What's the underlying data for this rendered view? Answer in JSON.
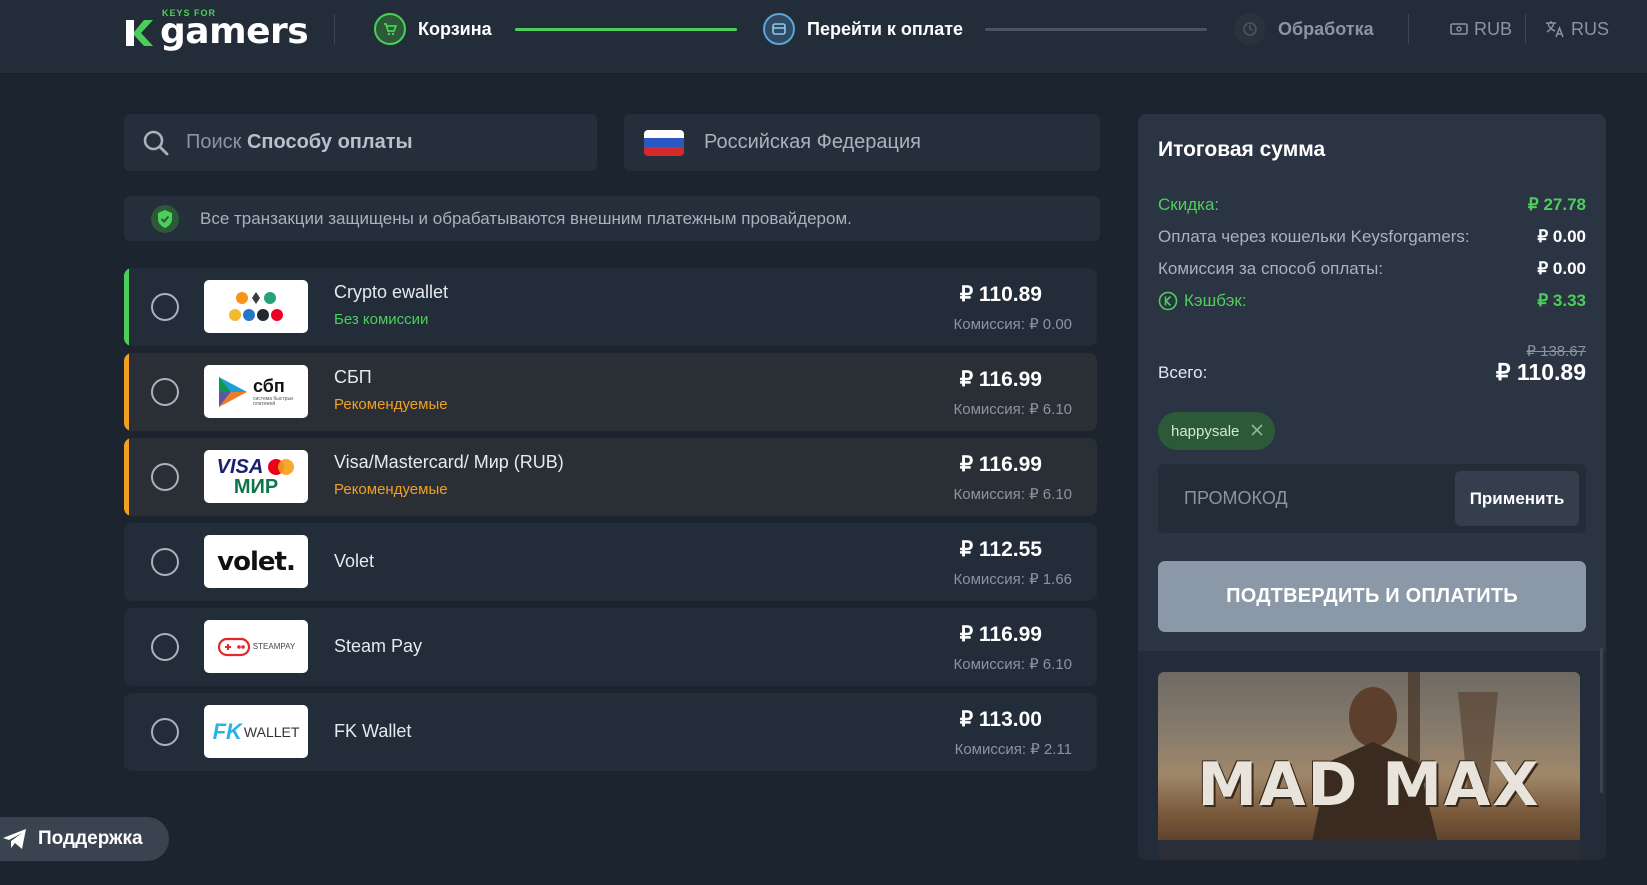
{
  "header": {
    "logo_small": "KEYS FOR",
    "logo_text": "gamers",
    "steps": [
      {
        "label": "Корзина",
        "state": "done",
        "icon": "cart-icon"
      },
      {
        "label": "Перейти к оплате",
        "state": "active",
        "icon": "card-icon"
      },
      {
        "label": "Обработка",
        "state": "pending",
        "icon": "clock-icon"
      }
    ],
    "currency": "RUB",
    "language": "RUS"
  },
  "search": {
    "placeholder_prefix": "Поиск",
    "placeholder_bold": "Способу оплаты"
  },
  "country": {
    "name": "Российская Федерация"
  },
  "notice": "Все транзакции защищены и обрабатываются внешним платежным провайдером.",
  "payment_methods": [
    {
      "name": "Crypto ewallet",
      "tag": "Без комиссии",
      "tag_color": "#4ccf5a",
      "accent": "#4ccf5a",
      "price": "₽ 110.89",
      "fee": "Комиссия: ₽ 0.00",
      "logo": "crypto-logo"
    },
    {
      "name": "СБП",
      "tag": "Рекомендуемые",
      "tag_color": "#f2a024",
      "accent": "#f2a024",
      "price": "₽ 116.99",
      "fee": "Комиссия: ₽ 6.10",
      "logo": "sbp-logo"
    },
    {
      "name": "Visa/Mastercard/ Мир (RUB)",
      "tag": "Рекомендуемые",
      "tag_color": "#f2a024",
      "accent": "#f2a024",
      "price": "₽ 116.99",
      "fee": "Комиссия: ₽ 6.10",
      "logo": "visa-mir-logo"
    },
    {
      "name": "Volet",
      "tag": "",
      "price": "₽ 112.55",
      "fee": "Комиссия: ₽ 1.66",
      "logo": "volet-logo",
      "logo_text": "volet."
    },
    {
      "name": "Steam Pay",
      "tag": "",
      "price": "₽ 116.99",
      "fee": "Комиссия: ₽ 6.10",
      "logo": "steampay-logo",
      "logo_text": "STEAMPAY"
    },
    {
      "name": "FK Wallet",
      "tag": "",
      "price": "₽ 113.00",
      "fee": "Комиссия: ₽ 2.11",
      "logo": "fkwallet-logo",
      "logo_text": "WALLET"
    }
  ],
  "logo_texts": {
    "sbp": "сбп",
    "sbp_sub": "система быстрых платежей",
    "visa": "VISA",
    "mir": "МИР",
    "fk": "FK"
  },
  "support": {
    "label": "Поддержка"
  },
  "summary": {
    "title": "Итоговая сумма",
    "rows": [
      {
        "label": "Скидка:",
        "value": "₽ 27.78"
      },
      {
        "label": "Оплата через кошельки Keysforgamers:",
        "value": "₽ 0.00"
      },
      {
        "label": "Комиссия за способ оплаты:",
        "value": "₽ 0.00"
      },
      {
        "label": "Кэшбэк:",
        "value": "₽ 3.33"
      }
    ],
    "old_total": "₽ 138.67",
    "total_label": "Всего:",
    "total": "₽ 110.89",
    "coupon": "happysale",
    "promo_placeholder": "ПРОМОКОД",
    "apply": "Применить",
    "pay": "ПОДТВЕРДИТЬ И ОПЛАТИТЬ",
    "game_title": "MAD MAX"
  },
  "colors": {
    "green": "#4ccf5a",
    "orange": "#f2a024",
    "bg": "#1c2430"
  }
}
